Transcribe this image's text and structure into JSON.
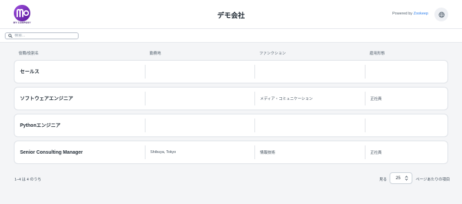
{
  "header": {
    "logo_text": "MY COMPANY",
    "title": "デモ会社",
    "powered_prefix": "Powered by ",
    "powered_brand": "Zookeep",
    "brand_color": "#2f80ed",
    "logo_color": "#7b2cbf",
    "globe_icon": "globe-icon"
  },
  "search": {
    "placeholder": "検索...",
    "value": "",
    "icon": "search-icon"
  },
  "table": {
    "columns": [
      "役職/役割名",
      "勤務地",
      "ファンクション",
      "雇用形態"
    ],
    "rows": [
      {
        "role": "セールス",
        "location": "",
        "function": "",
        "employment": ""
      },
      {
        "role": "ソフトウェアエンジニア",
        "location": "",
        "function": "メディア・コミュニケーション",
        "employment": "正社員"
      },
      {
        "role": "Pythonエンジニア",
        "location": "",
        "function": "",
        "employment": ""
      },
      {
        "role": "Senior Consulting Manager",
        "location": "Shibuya, Tokyo",
        "function": "情報技術",
        "employment": "正社員"
      }
    ]
  },
  "footer": {
    "count_text": "1–4 は 4 のうち",
    "show_label": "見る",
    "per_page_value": "25",
    "per_page_label": "ページあたりの項目"
  }
}
